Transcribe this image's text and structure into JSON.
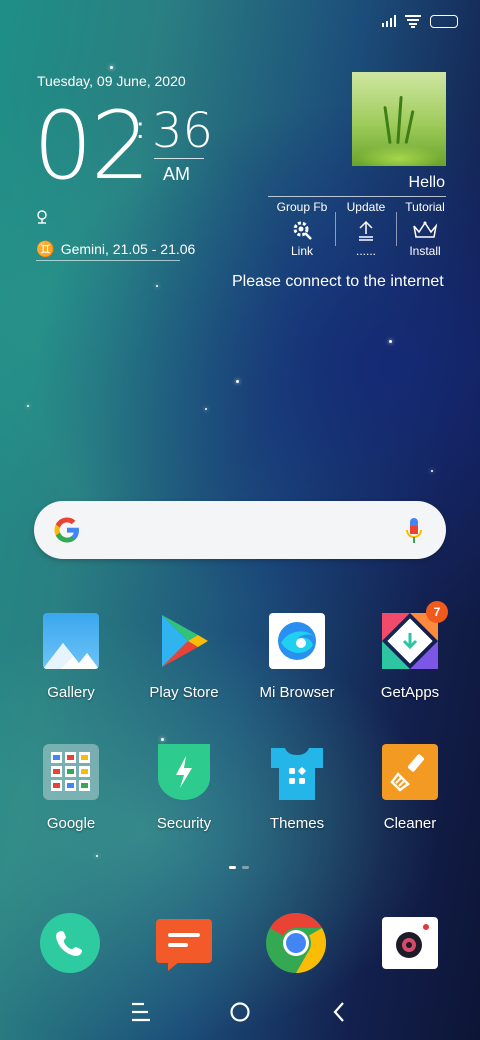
{
  "status_bar": {
    "icons": [
      "signal-icon",
      "wifi-icon",
      "battery-icon"
    ]
  },
  "clock_widget": {
    "date": "Tuesday, 09 June, 2020",
    "hour": "02",
    "minute": "36",
    "ampm": "AM",
    "alarm_icon": "alarm-icon",
    "zodiac": "Gemini, 21.05 - 21.06"
  },
  "right_widget": {
    "greeting": "Hello",
    "columns": [
      {
        "top_label": "Group Fb",
        "icon": "gear-icon",
        "bottom_label": "Link"
      },
      {
        "top_label": "Update",
        "icon": "upload-icon",
        "bottom_label": "......"
      },
      {
        "top_label": "Tutorial",
        "icon": "crown-icon",
        "bottom_label": "Install"
      }
    ],
    "message": "Please connect to the internet"
  },
  "search_bar": {
    "logo": "google-logo",
    "mic": "mic-icon"
  },
  "apps": [
    {
      "label": "Gallery",
      "icon": "gallery-icon"
    },
    {
      "label": "Play Store",
      "icon": "play-store-icon"
    },
    {
      "label": "Mi Browser",
      "icon": "mi-browser-icon"
    },
    {
      "label": "GetApps",
      "icon": "getapps-icon",
      "badge": "7"
    },
    {
      "label": "Google",
      "icon": "google-folder-icon"
    },
    {
      "label": "Security",
      "icon": "security-icon"
    },
    {
      "label": "Themes",
      "icon": "themes-icon"
    },
    {
      "label": "Cleaner",
      "icon": "cleaner-icon"
    }
  ],
  "page_indicator": {
    "pages": 2,
    "current": 1
  },
  "dock": [
    {
      "icon": "phone-icon"
    },
    {
      "icon": "messages-icon"
    },
    {
      "icon": "chrome-icon"
    },
    {
      "icon": "camera-icon"
    }
  ],
  "nav_bar": {
    "buttons": [
      "menu-icon",
      "home-icon",
      "back-icon"
    ]
  }
}
